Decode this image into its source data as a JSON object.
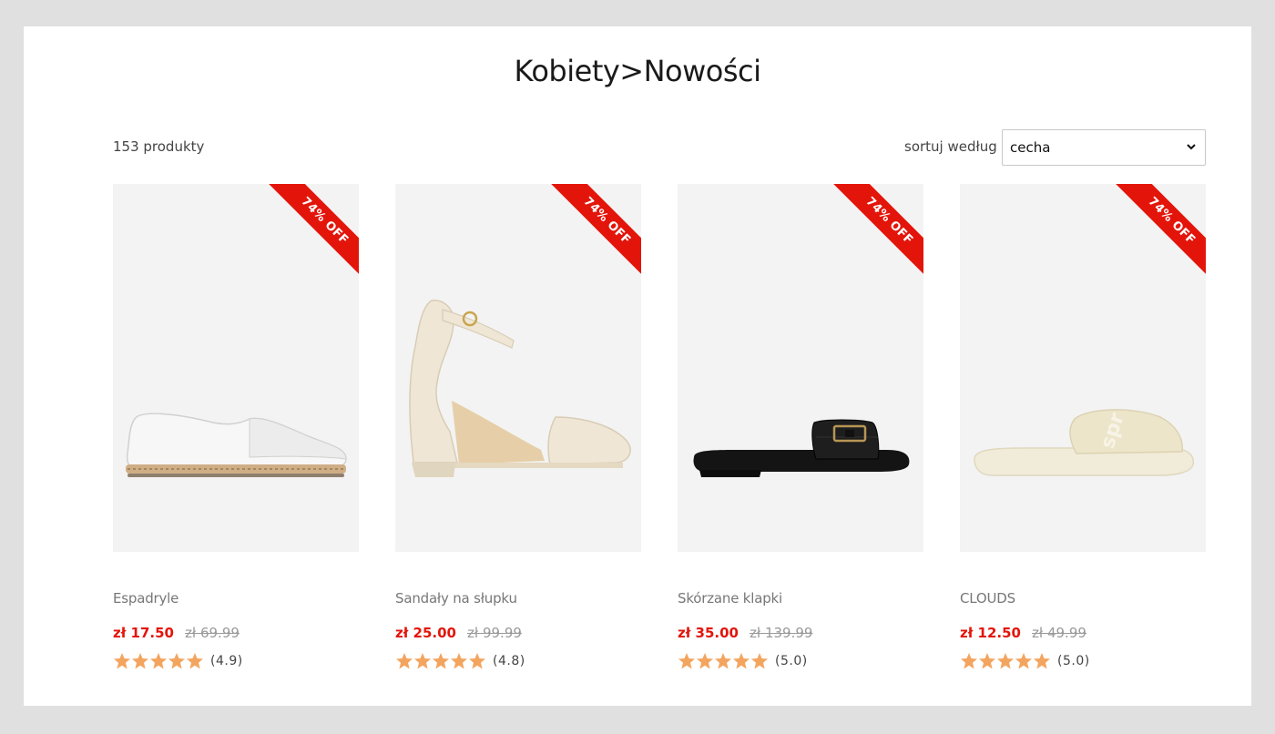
{
  "breadcrumb": {
    "title": "Kobiety>Nowości"
  },
  "toolbar": {
    "count": "153 produkty",
    "sort_label": "sortuj według",
    "sort_value": "cecha"
  },
  "colors": {
    "accent": "#e3150b",
    "star": "#f3a55f",
    "image_bg": "#f3f3f3"
  },
  "products": [
    {
      "name": "Espadryle",
      "price": "zł 17.50",
      "old_price": "zł 69.99",
      "badge": "74% OFF",
      "rating": "(4.9)",
      "stars": 5,
      "image_icon": "espadrille-shoe"
    },
    {
      "name": "Sandały na słupku",
      "price": "zł 25.00",
      "old_price": "zł 99.99",
      "badge": "74% OFF",
      "rating": "(4.8)",
      "stars": 5,
      "image_icon": "block-heel-sandal"
    },
    {
      "name": "Skórzane klapki",
      "price": "zł 35.00",
      "old_price": "zł 139.99",
      "badge": "74% OFF",
      "rating": "(5.0)",
      "stars": 5,
      "image_icon": "leather-slide"
    },
    {
      "name": "CLOUDS",
      "price": "zł 12.50",
      "old_price": "zł 49.99",
      "badge": "74% OFF",
      "rating": "(5.0)",
      "stars": 5,
      "image_icon": "pool-slide"
    }
  ]
}
